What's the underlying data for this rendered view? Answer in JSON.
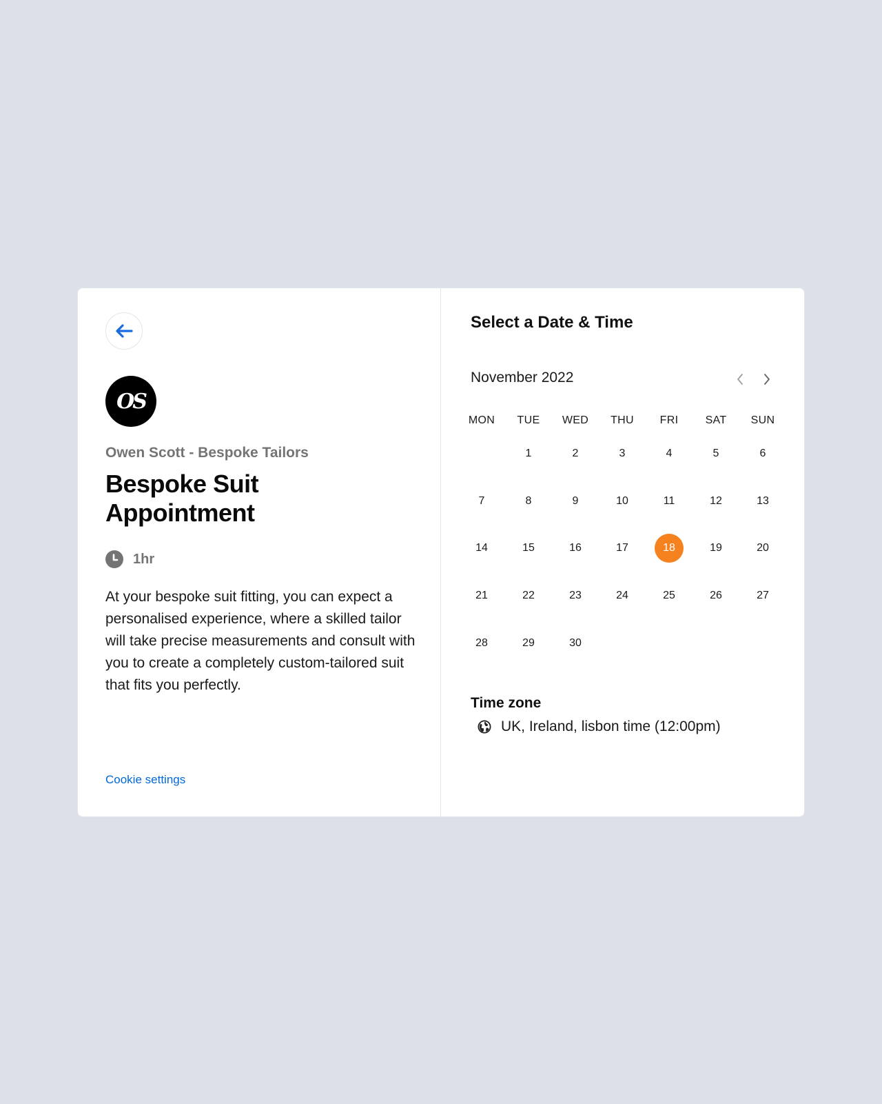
{
  "event": {
    "logo_text": "OS",
    "org_name": "Owen Scott - Bespoke Tailors",
    "title": "Bespoke Suit Appointment",
    "duration": "1hr",
    "description": "At your bespoke suit fitting, you can expect a personalised experience, where a skilled tailor will take precise measurements and consult with you to create a completely custom-tailored suit that fits you perfectly.",
    "cookie_link": "Cookie settings"
  },
  "scheduler": {
    "title": "Select a Date & Time",
    "month": "November 2022",
    "weekdays": [
      "MON",
      "TUE",
      "WED",
      "THU",
      "FRI",
      "SAT",
      "SUN"
    ],
    "first_weekday_index": 1,
    "days_in_month": 30,
    "selected_day": 18,
    "timezone_label": "Time zone",
    "timezone_value": "UK, Ireland, lisbon time (12:00pm)"
  },
  "colors": {
    "accent": "#f5821f",
    "link": "#0069d9",
    "background": "#dce1e9"
  },
  "icons": {
    "back": "arrow-left-icon",
    "duration": "clock-icon",
    "prev": "chevron-left-icon",
    "next": "chevron-right-icon",
    "timezone": "globe-icon"
  }
}
